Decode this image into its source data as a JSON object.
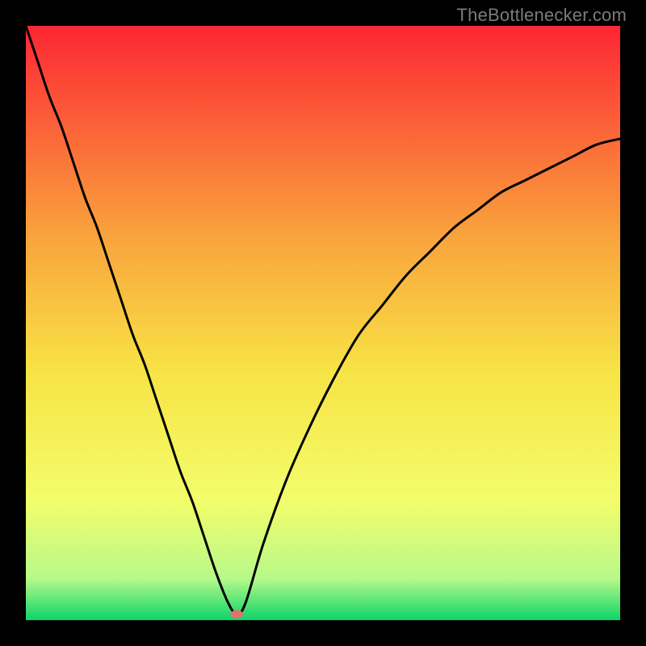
{
  "watermark": "TheBottlenecker.com",
  "chart_data": {
    "type": "line",
    "title": "",
    "xlabel": "",
    "ylabel": "",
    "xlim": [
      0,
      100
    ],
    "ylim": [
      0,
      100
    ],
    "gradient_colors": {
      "top": "#fd2634",
      "mid_upper": "#f9a23c",
      "mid": "#f7e345",
      "mid_lower": "#f3fd6b",
      "low": "#b7f98a",
      "bottom": "#0cd468"
    },
    "x": [
      0,
      2,
      4,
      6,
      8,
      10,
      12,
      14,
      16,
      18,
      20,
      22,
      24,
      26,
      28,
      30,
      32,
      34,
      35.5,
      37,
      40,
      44,
      48,
      52,
      56,
      60,
      64,
      68,
      72,
      76,
      80,
      84,
      88,
      92,
      96,
      100
    ],
    "values": [
      100,
      94,
      88,
      83,
      77,
      71,
      66,
      60,
      54,
      48,
      43,
      37,
      31,
      25,
      20,
      14,
      8,
      3,
      1,
      3,
      13,
      24,
      33,
      41,
      48,
      53,
      58,
      62,
      66,
      69,
      72,
      74,
      76,
      78,
      80,
      81
    ],
    "marker": {
      "x": 35.5,
      "y": 1,
      "color": "#e1706f"
    }
  }
}
